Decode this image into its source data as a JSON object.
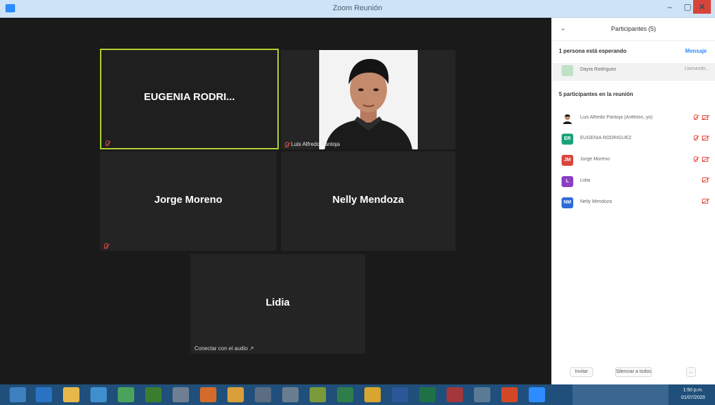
{
  "window": {
    "title": "Zoom Reunión",
    "min_label": "–",
    "max_label": "▢",
    "close_label": "✕"
  },
  "tiles": [
    {
      "id": "eugenia",
      "name": "EUGENIA  RODRI...",
      "caption": ""
    },
    {
      "id": "luis",
      "name": "",
      "caption": "Luis Alfredo Pantoja"
    },
    {
      "id": "jorge",
      "name": "Jorge Moreno",
      "caption": ""
    },
    {
      "id": "nelly",
      "name": "Nelly Mendoza",
      "caption": ""
    },
    {
      "id": "lidia",
      "name": "Lidia",
      "caption": "Conectar con el audio ↗"
    }
  ],
  "panel": {
    "title": "Participantes (5)",
    "collapse": "⌄",
    "waiting_label": "1 persona está esperando",
    "message_link": "Mensaje",
    "waiting": {
      "name": "Dayra Rodríguez",
      "status": "Llamando..."
    },
    "in_meeting_label": "5 participantes en la reunión",
    "participants": [
      {
        "initials": "",
        "name": "Luis Alfredo Pantoja (Anfitrión, yo)",
        "color": "#b35f2a"
      },
      {
        "initials": "ER",
        "name": "EUGENIA RODRIGUEZ",
        "color": "#1aa37a"
      },
      {
        "initials": "JM",
        "name": "Jorge Moreno",
        "color": "#d9463f"
      },
      {
        "initials": "L",
        "name": "Lidia",
        "color": "#8a3fc4"
      },
      {
        "initials": "NM",
        "name": "Nelly Mendoza",
        "color": "#2d6bd6"
      }
    ],
    "invite": "Invitar",
    "mute_all": "Silenciar a todos",
    "more": "..."
  },
  "taskbar": {
    "clock_time": "1:50 p.m.",
    "clock_date": "01/07/2020"
  },
  "colors": {
    "active_speaker": "#b3d234",
    "accent": "#2d8cff",
    "muted": "#e04b3c"
  }
}
